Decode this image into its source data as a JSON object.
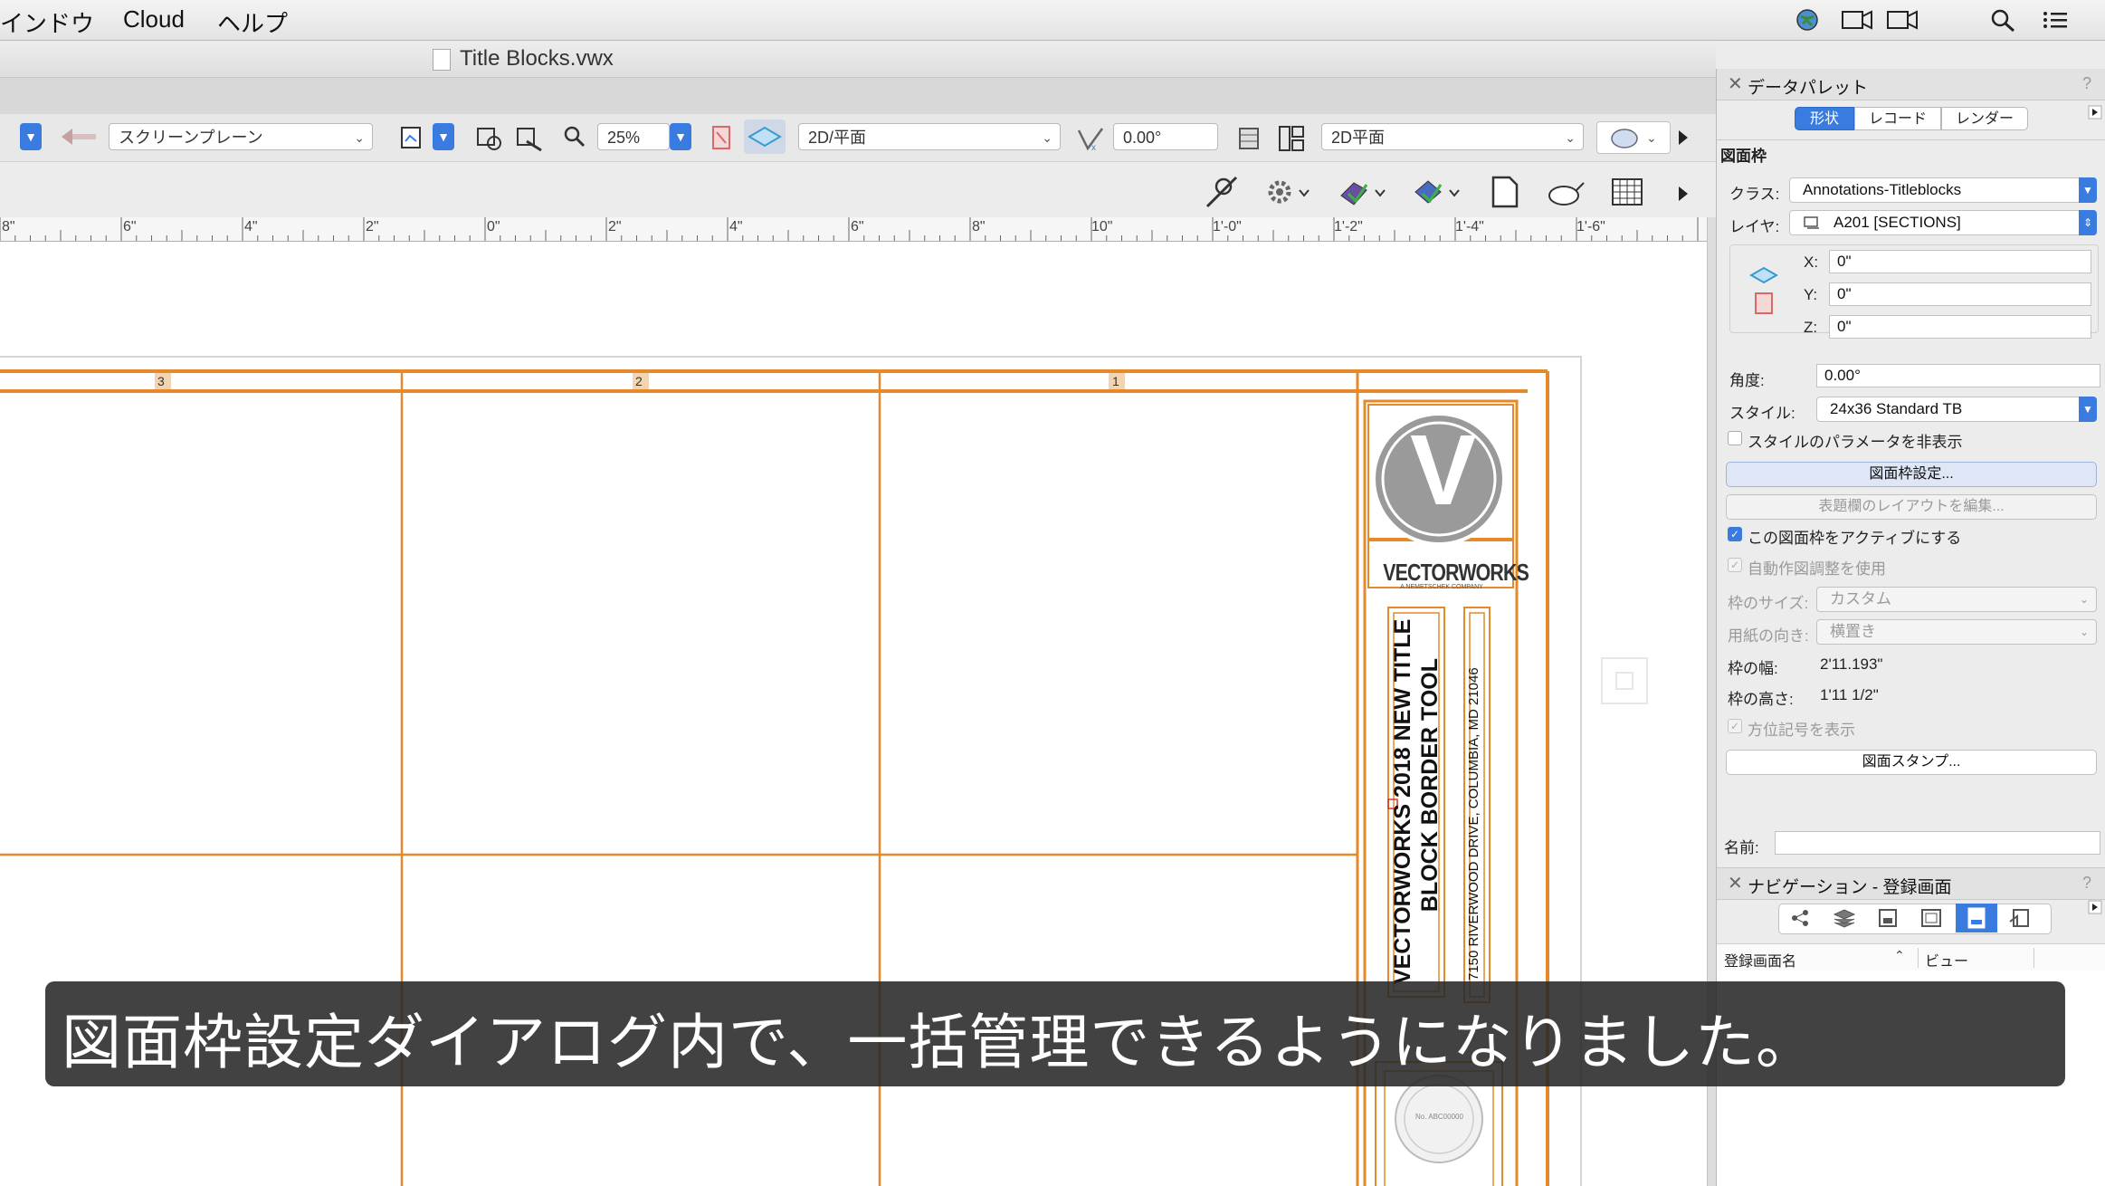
{
  "menubar": {
    "items": [
      "インドウ",
      "Cloud",
      "ヘルプ"
    ]
  },
  "window": {
    "title": "Title Blocks.vwx"
  },
  "toolbar": {
    "plane_mode": "スクリーンプレーン",
    "zoom": "25%",
    "view": "2D/平面",
    "rotation": "0.00°",
    "render_mode": "2D平面"
  },
  "ruler": {
    "labels": [
      "8\"",
      "6\"",
      "4\"",
      "2\"",
      "0\"",
      "2\"",
      "4\"",
      "6\"",
      "8\"",
      "10\"",
      "1'-0\"",
      "1'-2\"",
      "1'-4\"",
      "1'-6\""
    ]
  },
  "drawing": {
    "column_numbers": [
      "3",
      "2",
      "1"
    ],
    "logo_text": "VECTORWORKS",
    "logo_sub": "A NEMETSCHEK COMPANY",
    "logo_letter": "V",
    "title_line1": "VECTORWORKS 2018  NEW TITLE",
    "title_line2": "BLOCK BORDER TOOL",
    "address": "7150 RIVERWOOD DRIVE, COLUMBIA, MD 21046",
    "seal_number": "No. ABC00000"
  },
  "data_palette": {
    "title": "データパレット",
    "help": "?",
    "tabs": [
      "形状",
      "レコード",
      "レンダー"
    ],
    "section": "図面枠",
    "class_label": "クラス:",
    "class_value": "Annotations-Titleblocks",
    "layer_label": "レイヤ:",
    "layer_value": "A201 [SECTIONS]",
    "x_label": "X:",
    "x_value": "0\"",
    "y_label": "Y:",
    "y_value": "0\"",
    "z_label": "Z:",
    "z_value": "0\"",
    "angle_label": "角度:",
    "angle_value": "0.00°",
    "style_label": "スタイル:",
    "style_value": "24x36 Standard TB",
    "hide_style_params": "スタイルのパラメータを非表示",
    "border_settings_btn": "図面枠設定...",
    "edit_layout_btn": "表題欄のレイアウトを編集...",
    "activate_cb": "この図面枠をアクティブにする",
    "auto_adjust_cb": "自動作図調整を使用",
    "size_label": "枠のサイズ:",
    "size_value": "カスタム",
    "orientation_label": "用紙の向き:",
    "orientation_value": "横置き",
    "width_label": "枠の幅:",
    "width_value": "2'11.193\"",
    "height_label": "枠の高さ:",
    "height_value": "1'11 1/2\"",
    "north_cb": "方位記号を表示",
    "stamp_btn": "図面スタンプ...",
    "name_label": "名前:"
  },
  "nav_palette": {
    "title": "ナビゲーション - 登録画面",
    "help": "?",
    "col_name": "登録画面名",
    "col_view": "ビュー"
  },
  "subtitle": "図面枠設定ダイアログ内で、一括管理できるようになりました。",
  "colors": {
    "border_orange": "#e58a2a",
    "accent_blue": "#3a7be0"
  }
}
